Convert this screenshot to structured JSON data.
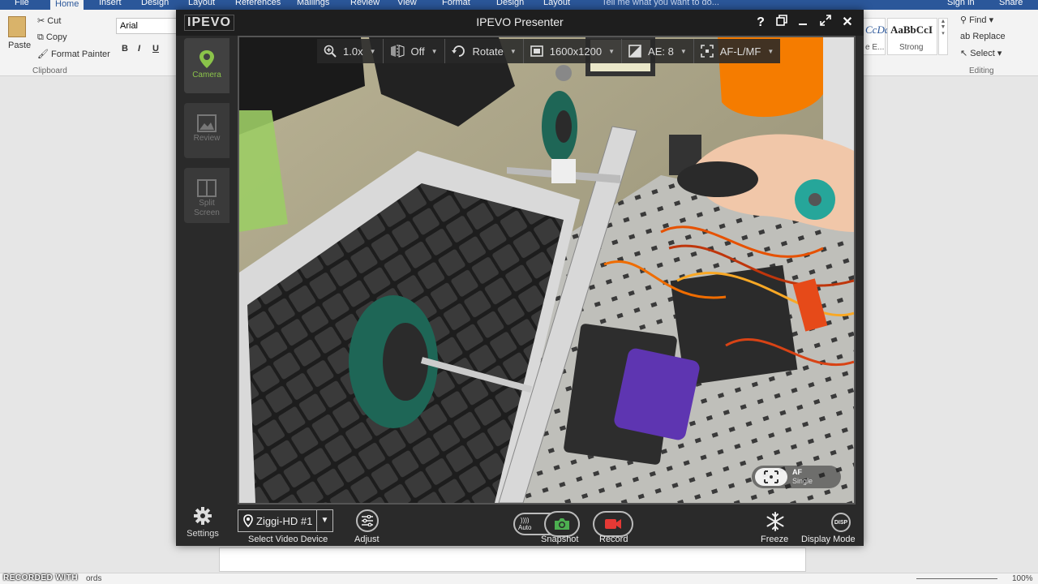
{
  "word": {
    "tabs": [
      "File",
      "Home",
      "Insert",
      "Design",
      "Layout",
      "References",
      "Mailings",
      "Review",
      "View",
      "Design",
      "Layout",
      "Format"
    ],
    "tell_me": "Tell me what you want to do...",
    "sign_in": "Sign in",
    "share": "Share",
    "clipboard": {
      "paste": "Paste",
      "cut": "Cut",
      "copy": "Copy",
      "format_painter": "Format Painter",
      "group": "Clipboard"
    },
    "font": {
      "name": "Arial",
      "bold": "B",
      "italic": "I",
      "underline": "U"
    },
    "styles": {
      "style1": "CcDdI",
      "style1_sub": "e E...",
      "style2": "AaBbCcI",
      "style2_sub": "Strong"
    },
    "editing": {
      "find": "Find",
      "replace": "Replace",
      "select": "Select",
      "group": "Editing"
    },
    "status": {
      "words": "ords",
      "zoom": "100%"
    }
  },
  "ipevo": {
    "logo": "IPEVO",
    "title": "IPEVO Presenter",
    "window_buttons": {
      "help": "?",
      "close": "✕"
    },
    "sidebar": [
      {
        "label": "Camera",
        "active": true
      },
      {
        "label": "Review",
        "active": false
      },
      {
        "label": "Split Screen",
        "active": false
      }
    ],
    "settings_label": "Settings",
    "toolbar": {
      "zoom": "1.0x",
      "mirror": "Off",
      "rotate": "Rotate",
      "resolution": "1600x1200",
      "exposure": "AE: 8",
      "focus": "AF-L/MF"
    },
    "af_badge": {
      "line1": "AF",
      "line2": "Single"
    },
    "bottom": {
      "device": "Ziggi-HD #1",
      "select_device": "Select Video Device",
      "adjust": "Adjust",
      "auto": "Auto",
      "snapshot": "Snapshot",
      "record": "Record",
      "freeze": "Freeze",
      "display_mode": "Display Mode",
      "disp_icon_text": "DISP"
    },
    "colors": {
      "accent": "#8bc34a",
      "record": "#e53935",
      "snapshot": "#4caf50"
    }
  },
  "recorder": "RECORDED WITH"
}
